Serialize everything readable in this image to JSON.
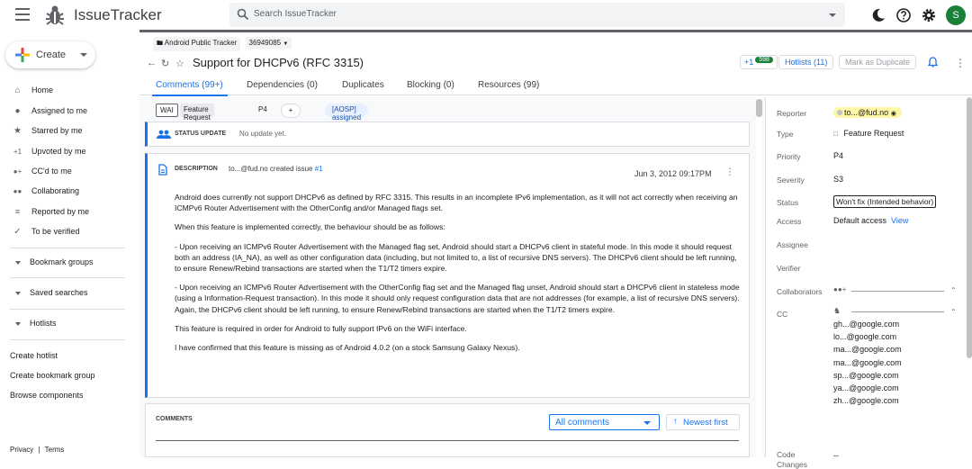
{
  "app": {
    "title": "IssueTracker",
    "user_initial": "S"
  },
  "search": {
    "placeholder": "Search IssueTracker"
  },
  "sidebar": {
    "create_label": "Create",
    "items": [
      {
        "label": "Home",
        "icon": "home-icon"
      },
      {
        "label": "Assigned to me",
        "icon": "person-icon"
      },
      {
        "label": "Starred by me",
        "icon": "star-icon"
      },
      {
        "label": "Upvoted by me",
        "icon": "plus-one-icon"
      },
      {
        "label": "CC'd to me",
        "icon": "person-add-icon"
      },
      {
        "label": "Collaborating",
        "icon": "people-icon"
      },
      {
        "label": "Reported by me",
        "icon": "report-icon"
      },
      {
        "label": "To be verified",
        "icon": "check-icon"
      }
    ],
    "groups": [
      "Bookmark groups",
      "Saved searches",
      "Hotlists"
    ],
    "links": [
      "Create hotlist",
      "Create bookmark group",
      "Browse components"
    ],
    "footer": {
      "privacy": "Privacy",
      "sep": "|",
      "terms": "Terms"
    }
  },
  "issue": {
    "breadcrumb": [
      "Android Public Tracker",
      "36949085"
    ],
    "title": "Support for DHCPv6 (RFC 3315)",
    "plus_one": "+1",
    "votes": "598",
    "hotlists_label": "Hotlists (11)",
    "duplicate_label": "Mark as Duplicate",
    "tabs": [
      "Comments (99+)",
      "Dependencies (0)",
      "Duplicates",
      "Blocking (0)",
      "Resources (99)"
    ],
    "chips": {
      "wai": "WAI",
      "type": "Feature Request",
      "priority": "P4",
      "add": "+",
      "hotlist": "[AOSP] assigned"
    },
    "status_update": {
      "heading": "STATUS UPDATE",
      "text": "No update yet."
    },
    "description": {
      "heading": "DESCRIPTION",
      "author": "to...@fud.no created issue",
      "ref": "#1",
      "date": "Jun 3, 2012 09:17PM",
      "paragraphs": [
        "Android does currently not support DHCPv6 as defined by RFC 3315. This results in an incomplete IPv6 implementation, as it will not act correctly when receiving an ICMPv6 Router Advertisement with the OtherConfig and/or Managed flags set.",
        "When this feature is implemented correctly, the behaviour should be as follows:",
        "- Upon receiving an ICMPv6 Router Advertisement with the Managed flag set, Android should start a DHCPv6 client in stateful mode. In this mode it should request both an address (IA_NA), as well as other configuration data (including, but not limited to, a list of recursive DNS servers). The DHCPv6 client should be left running, to ensure Renew/Rebind transactions are started when the T1/T2 timers expire.",
        "- Upon receiving an ICMPv6 Router Advertisement with the OtherConfig flag set and the Managed flag unset, Android should start a DHCPv6 client in stateless mode (using a Information-Request transaction). In this mode it should only request configuration data that are not addresses (for example, a list of recursive DNS servers). Again, the DHCPv6 client should be left running, to ensure Renew/Rebind transactions are started when the T1/T2 timers expire.",
        "This feature is required in order for Android to fully support IPv6 on the WiFi interface.",
        "I have confirmed that this feature is missing as of Android 4.0.2 (on a stock Samsung Galaxy Nexus)."
      ]
    },
    "comments": {
      "heading": "COMMENTS",
      "filter": "All comments",
      "sort": "Newest first",
      "sort_arrow": "↑"
    }
  },
  "properties": {
    "reporter": {
      "label": "Reporter",
      "value": "to...@fud.no"
    },
    "type": {
      "label": "Type",
      "value": "Feature Request"
    },
    "priority": {
      "label": "Priority",
      "value": "P4"
    },
    "severity": {
      "label": "Severity",
      "value": "S3"
    },
    "status": {
      "label": "Status",
      "value": "Won't fix (Intended behavior)"
    },
    "access": {
      "label": "Access",
      "value": "Default access",
      "link": "View"
    },
    "assignee": {
      "label": "Assignee"
    },
    "verifier": {
      "label": "Verifier"
    },
    "collaborators": {
      "label": "Collaborators"
    },
    "cc": {
      "label": "CC",
      "list": [
        "gh...@google.com",
        "lo...@google.com",
        "ma...@google.com",
        "ma...@google.com",
        "sp...@google.com",
        "ya...@google.com",
        "zh...@google.com"
      ]
    },
    "code_changes": {
      "label1": "Code",
      "label2": "Changes",
      "value": "--"
    }
  }
}
